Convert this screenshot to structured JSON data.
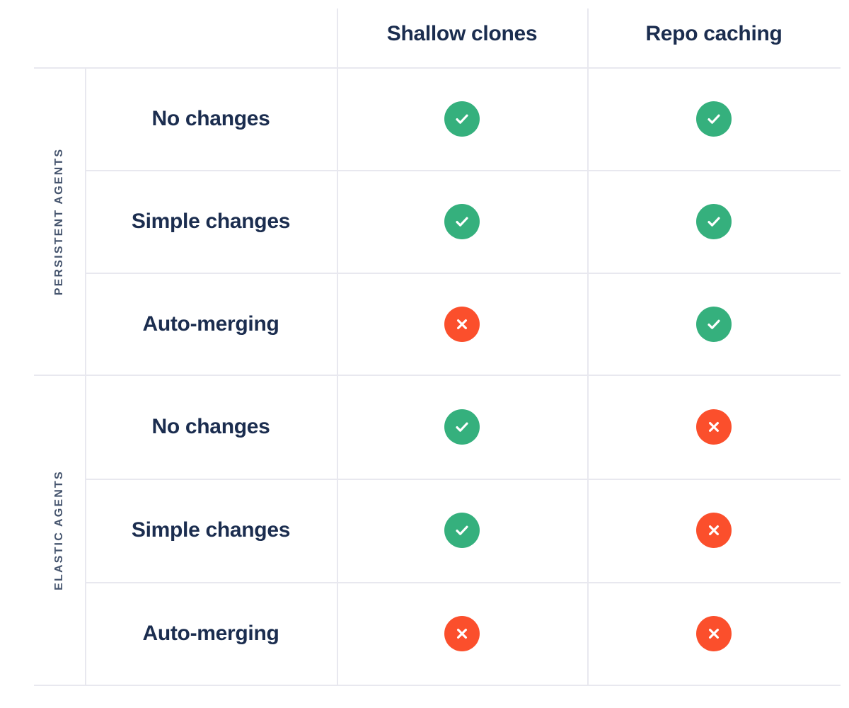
{
  "table": {
    "corner_label": "",
    "columns": [
      {
        "key": "shallow_clones",
        "label": "Shallow clones"
      },
      {
        "key": "repo_caching",
        "label": "Repo caching"
      }
    ],
    "groups": [
      {
        "label": "PERSISTENT AGENTS",
        "rows": [
          {
            "label": "No changes",
            "shallow_clones": "yes",
            "repo_caching": "yes"
          },
          {
            "label": "Simple changes",
            "shallow_clones": "yes",
            "repo_caching": "yes"
          },
          {
            "label": "Auto-merging",
            "shallow_clones": "no",
            "repo_caching": "yes"
          }
        ]
      },
      {
        "label": "ELASTIC AGENTS",
        "rows": [
          {
            "label": "No changes",
            "shallow_clones": "yes",
            "repo_caching": "no"
          },
          {
            "label": "Simple changes",
            "shallow_clones": "yes",
            "repo_caching": "no"
          },
          {
            "label": "Auto-merging",
            "shallow_clones": "no",
            "repo_caching": "no"
          }
        ]
      }
    ]
  },
  "icons": {
    "yes": {
      "name": "check-circle-icon",
      "glyph": "check",
      "color": "#35b07d",
      "title": "Supported"
    },
    "no": {
      "name": "cross-circle-icon",
      "glyph": "cross",
      "color": "#fb4f2c",
      "title": "Not supported"
    }
  },
  "colors": {
    "text_primary": "#1b2d4f",
    "text_muted": "#46556e",
    "grid_line": "#e8e8ef",
    "background": "#ffffff",
    "success": "#35b07d",
    "failure": "#fb4f2c"
  }
}
